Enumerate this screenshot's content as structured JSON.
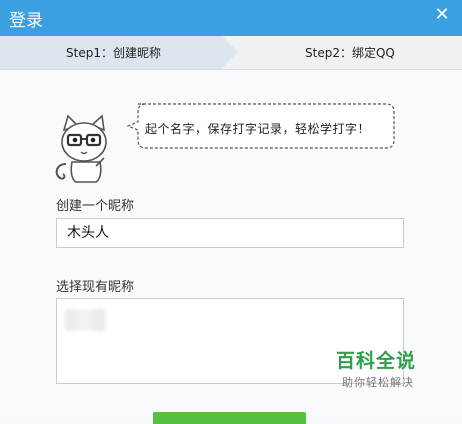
{
  "window": {
    "title": "登录",
    "close_glyph": "✕"
  },
  "steps": [
    {
      "label": "Step1：创建昵称",
      "active": true
    },
    {
      "label": "Step2：绑定QQ",
      "active": false
    }
  ],
  "bubble": {
    "text": "起个名字，保存打字记录，轻松学打字！"
  },
  "form": {
    "create_label": "创建一个昵称",
    "nickname_value": "木头人",
    "choose_label": "选择现有昵称"
  },
  "watermark": {
    "title": "百科全说",
    "subtitle": "助你轻松解决"
  },
  "colors": {
    "titlebar": "#3aa0df",
    "step_active": "#dde6ee",
    "button": "#56c043",
    "watermark": "#2e9f4a"
  }
}
